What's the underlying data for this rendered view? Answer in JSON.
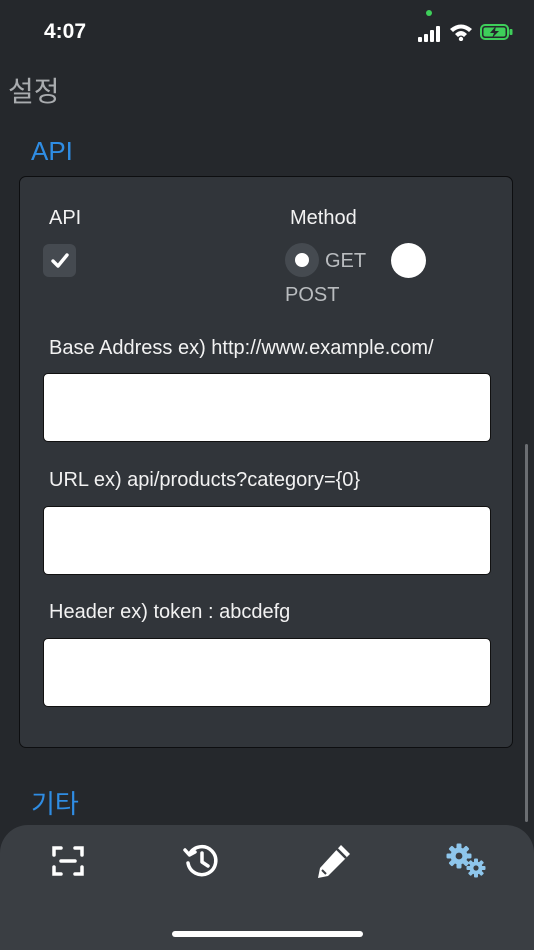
{
  "status_bar": {
    "time": "4:07"
  },
  "page": {
    "title": "설정"
  },
  "api_section": {
    "title": "API",
    "api_label": "API",
    "api_enabled": true,
    "method_label": "Method",
    "method_options": [
      "GET",
      "POST"
    ],
    "method_selected": "GET",
    "base_address": {
      "label": "Base Address ex) http://www.example.com/",
      "value": ""
    },
    "url": {
      "label": "URL ex) api/products?category={0}",
      "value": ""
    },
    "header": {
      "label": "Header ex) token : abcdefg",
      "value": ""
    }
  },
  "etc_section": {
    "title": "기타"
  },
  "tab_bar": {
    "tabs": [
      {
        "icon": "scan-icon"
      },
      {
        "icon": "history-icon"
      },
      {
        "icon": "pencil-icon"
      },
      {
        "icon": "gears-icon",
        "active": true
      }
    ]
  },
  "colors": {
    "background": "#25282c",
    "card": "#31353a",
    "accent": "#2f8de4",
    "active_tab": "#8ec6ec",
    "tab_bar": "#3a3e43"
  }
}
